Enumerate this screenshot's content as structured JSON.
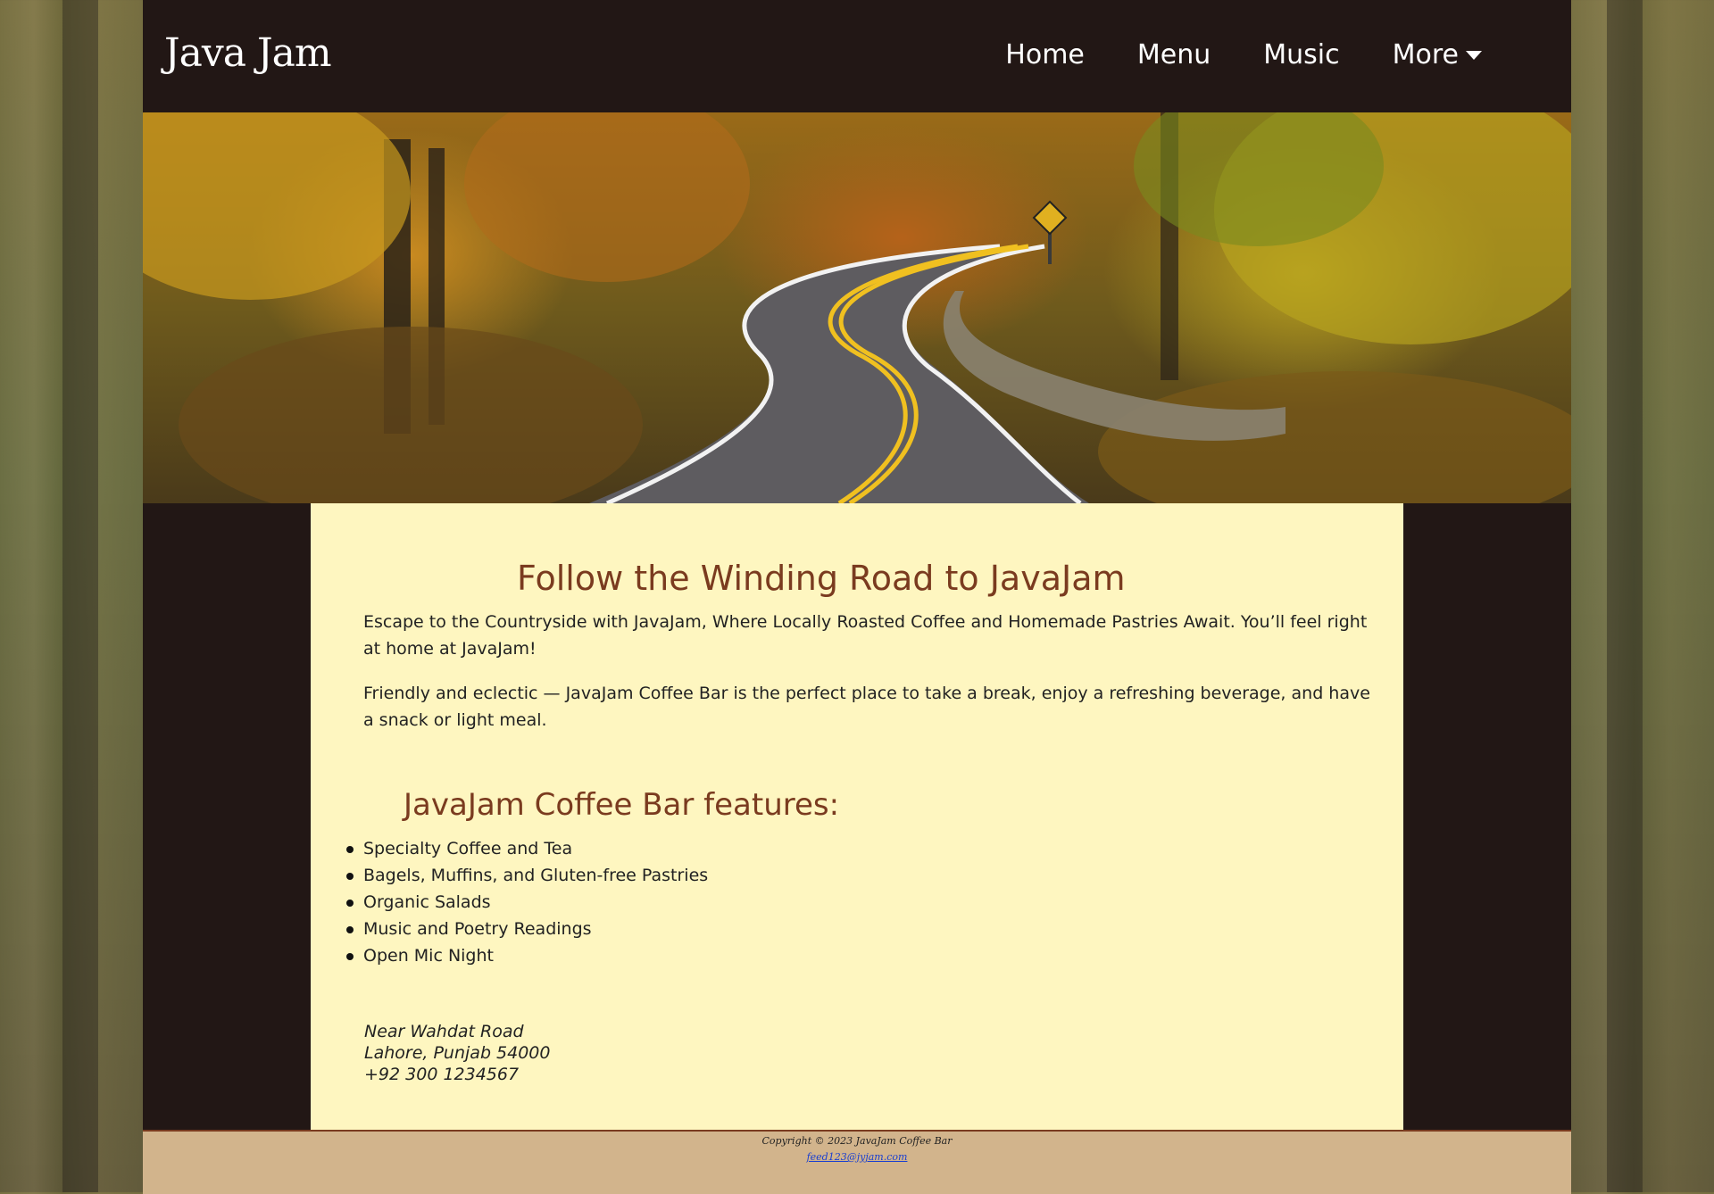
{
  "header": {
    "logo": "Java Jam",
    "nav": [
      {
        "label": "Home"
      },
      {
        "label": "Menu"
      },
      {
        "label": "Music"
      },
      {
        "label": "More"
      }
    ]
  },
  "hero": {
    "image_description": "winding-road-autumn-forest"
  },
  "main": {
    "heading": "Follow the Winding Road to JavaJam",
    "paragraphs": [
      "Escape to the Countryside with JavaJam, Where Locally Roasted Coffee and Homemade Pastries Await. You’ll feel right at home at JavaJam!",
      "Friendly and eclectic — JavaJam Coffee Bar is the perfect place to take a break, enjoy a refreshing beverage, and have a snack or light meal."
    ],
    "features_heading": "JavaJam Coffee Bar features:",
    "features": [
      "Specialty Coffee and Tea",
      "Bagels, Muffins, and Gluten-free Pastries",
      "Organic Salads",
      "Music and Poetry Readings",
      "Open Mic Night"
    ],
    "address": {
      "line1": "Near Wahdat Road",
      "line2": "Lahore, Punjab 54000",
      "phone": "+92 300 1234567"
    }
  },
  "footer": {
    "copyright": "Copyright © 2023 JavaJam Coffee Bar",
    "email": "feed123@jyjam.com"
  },
  "colors": {
    "dark_bg": "#221715",
    "content_bg": "#fef6c0",
    "heading": "#7a3b1f",
    "footer_bg": "#d2b48c",
    "link": "#1a3fd0"
  }
}
